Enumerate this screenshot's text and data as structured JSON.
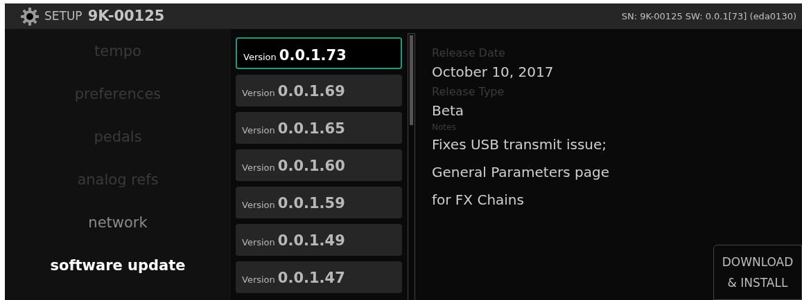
{
  "header": {
    "section": "SETUP",
    "device": "9K-00125",
    "info": "SN: 9K-00125 SW: 0.0.1[73] (eda0130)"
  },
  "nav": [
    {
      "label": "tempo",
      "selected": false,
      "disabled": true
    },
    {
      "label": "preferences",
      "selected": false,
      "disabled": true
    },
    {
      "label": "pedals",
      "selected": false,
      "disabled": true
    },
    {
      "label": "analog refs",
      "selected": false,
      "disabled": true
    },
    {
      "label": "network",
      "selected": false,
      "disabled": false
    },
    {
      "label": "software update",
      "selected": true,
      "disabled": false
    }
  ],
  "versions": [
    {
      "prefix": "Version",
      "number": "0.0.1.73",
      "selected": true
    },
    {
      "prefix": "Version",
      "number": "0.0.1.69",
      "selected": false
    },
    {
      "prefix": "Version",
      "number": "0.0.1.65",
      "selected": false
    },
    {
      "prefix": "Version",
      "number": "0.0.1.60",
      "selected": false
    },
    {
      "prefix": "Version",
      "number": "0.0.1.59",
      "selected": false
    },
    {
      "prefix": "Version",
      "number": "0.0.1.49",
      "selected": false
    },
    {
      "prefix": "Version",
      "number": "0.0.1.47",
      "selected": false
    }
  ],
  "details": [
    {
      "label": "Release Date",
      "value": "October 10, 2017",
      "kind": "large"
    },
    {
      "label": "Release Type",
      "value": "Beta",
      "kind": "large"
    },
    {
      "label": "Notes",
      "value": "Fixes USB transmit issue; General Parameters page for FX Chains",
      "kind": "small"
    }
  ],
  "action_button": {
    "line_1": "DOWNLOAD",
    "line_2": "& INSTALL"
  }
}
